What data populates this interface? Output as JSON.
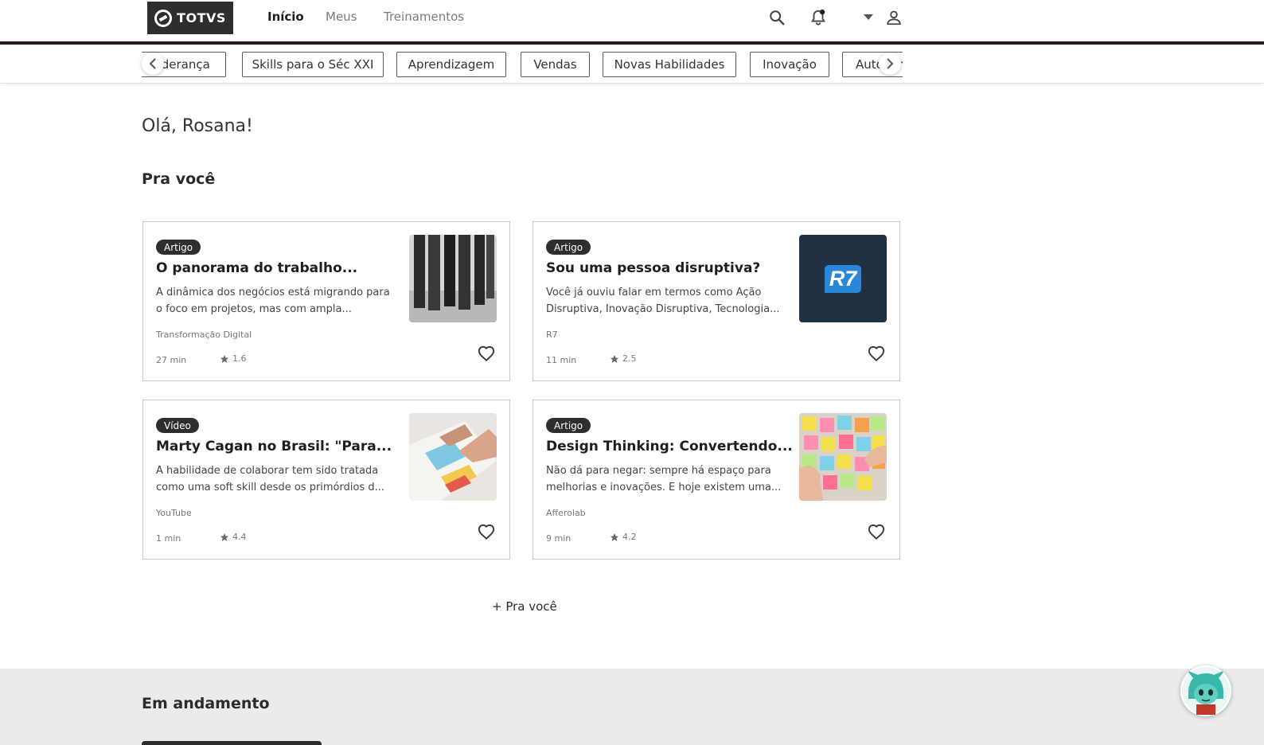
{
  "brand": {
    "logo_text": "TOTVS"
  },
  "nav": {
    "items": [
      {
        "label": "Início",
        "active": true
      },
      {
        "label": "Meus",
        "active": false
      },
      {
        "label": "Treinamentos",
        "active": false
      }
    ]
  },
  "categories": [
    "Liderança",
    "Skills para o Séc XXI",
    "Aprendizagem",
    "Vendas",
    "Novas Habilidades",
    "Inovação",
    "Autoconhecimento"
  ],
  "greeting": "Olá, Rosana!",
  "for_you": {
    "title": "Pra você",
    "more_label": "+ Pra você",
    "cards": [
      {
        "badge": "Artigo",
        "title": "O panorama do trabalho...",
        "description": "A dinâmica dos negócios está migrando para o foco em projetos, mas com ampla...",
        "source": "Transformação Digital",
        "duration": "27 min",
        "rating": "1.6",
        "thumbnail": "people-legs-photo"
      },
      {
        "badge": "Artigo",
        "title": "Sou uma pessoa disruptiva?",
        "description": "Você já ouviu falar em termos como Ação Disruptiva, Inovação Disruptiva, Tecnologia...",
        "source": "R7",
        "duration": "11 min",
        "rating": "2.5",
        "thumbnail": "r7-logo",
        "thumbnail_text": "R7"
      },
      {
        "badge": "Vídeo",
        "title": "Marty Cagan no Brasil: \"Para...",
        "description": "A habilidade de colaborar tem sido tratada como uma soft skill desde os primórdios d...",
        "source": "YouTube",
        "duration": "1 min",
        "rating": "4.4",
        "thumbnail": "hands-on-paper-photo"
      },
      {
        "badge": "Artigo",
        "title": "Design Thinking: Convertendo...",
        "description": "Não dá para negar: sempre há espaço para melhorias e inovações. E hoje existem uma...",
        "source": "Afferolab",
        "duration": "9 min",
        "rating": "4.2",
        "thumbnail": "sticky-notes-photo"
      }
    ]
  },
  "in_progress": {
    "title": "Em andamento"
  },
  "colors": {
    "dark": "#2e2e2e",
    "r7_bg": "#1f3143",
    "r7_blue": "#2a86d9",
    "footer_bg": "#ebebeb"
  },
  "icons": {
    "search": "search-icon",
    "bell": "bell-icon",
    "caret": "caret-down-icon",
    "user": "user-icon",
    "heart": "heart-icon",
    "star": "star-icon",
    "chevron_left": "chevron-left-icon",
    "chevron_right": "chevron-right-icon"
  }
}
